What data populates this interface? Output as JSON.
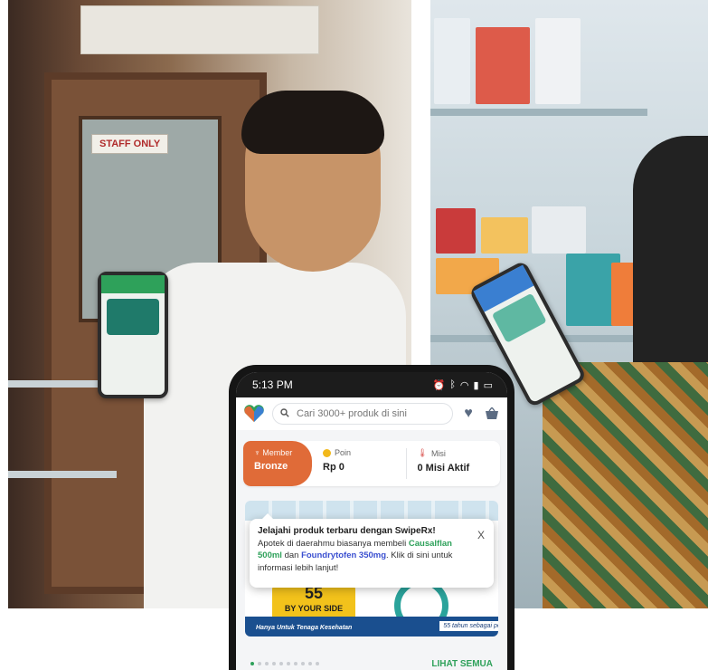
{
  "staff_sign": "STAFF ONLY",
  "status_bar": {
    "time": "5:13 PM"
  },
  "header": {
    "search_placeholder": "Cari 3000+ produk di sini"
  },
  "member_card": {
    "tier_label": "Member",
    "tier_value": "Bronze",
    "points_label": "Poin",
    "points_value": "Rp 0",
    "mission_label": "Misi",
    "mission_value": "0 Misi Aktif"
  },
  "banner": {
    "badge_big": "55",
    "badge_text": "BY YOUR SIDE",
    "strip_text": "Hanya Untuk Tenaga Kesehatan",
    "tagline": "55 tahun sebagai pelega"
  },
  "carousel": {
    "see_all": "LIHAT SEMUA",
    "dot_count": 10,
    "active_index": 0
  },
  "tooltip": {
    "title": "Jelajahi produk terbaru dengan SwipeRx!",
    "text_1": "Apotek di daerahmu biasanya membeli ",
    "product_1": "Causalflan 500ml",
    "text_2": " dan ",
    "product_2": "Foundrytofen 350mg",
    "text_3": ". Klik di sini untuk informasi lebih lanjut!",
    "close": "X"
  },
  "colors": {
    "brand_green": "#2ea15a",
    "member_orange": "#e06b38",
    "link_blue": "#3a4fd0"
  }
}
